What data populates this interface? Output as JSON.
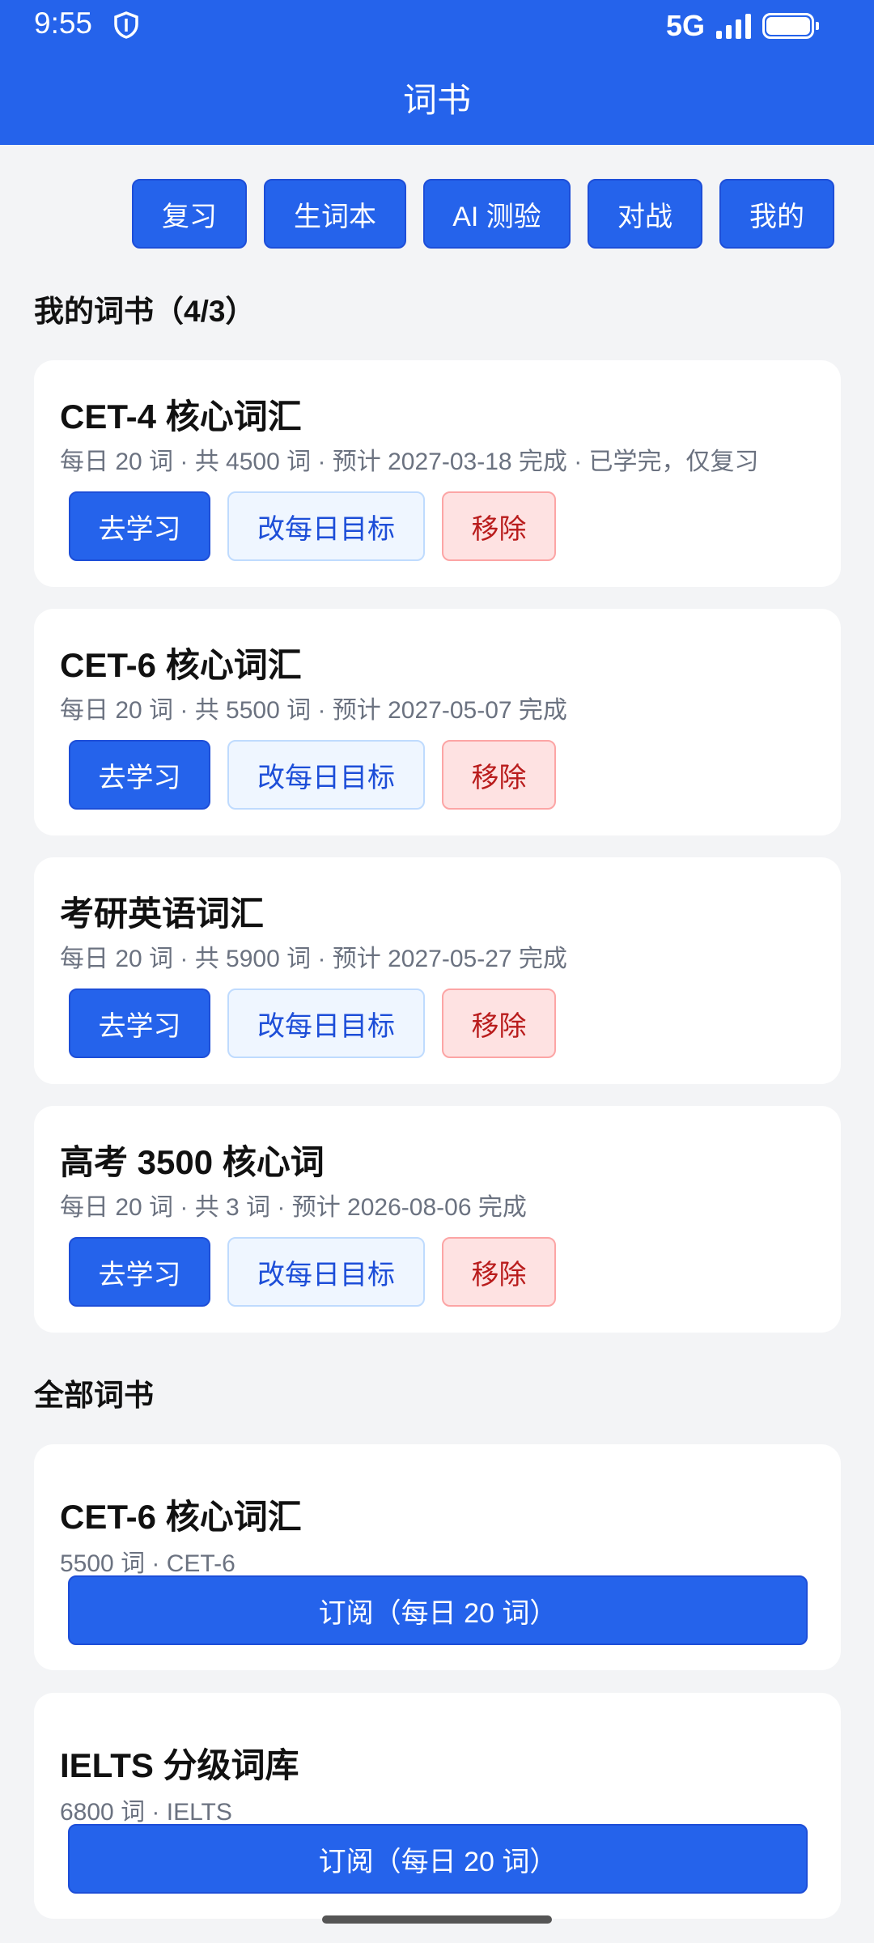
{
  "status_bar": {
    "time": "9:55",
    "network": "5G",
    "icons": [
      "shield-icon",
      "signal-icon",
      "battery-icon"
    ]
  },
  "header": {
    "title": "词书"
  },
  "nav": [
    {
      "label": "复习"
    },
    {
      "label": "生词本"
    },
    {
      "label": "AI 测验"
    },
    {
      "label": "对战"
    },
    {
      "label": "我的"
    }
  ],
  "my_books": {
    "title": "我的词书（4/3）",
    "items": [
      {
        "title": "CET-4 核心词汇",
        "meta": "每日 20 词 · 共 4500 词 · 预计 2027-03-18 完成 · 已学完，仅复习",
        "study": "去学习",
        "edit": "改每日目标",
        "remove": "移除"
      },
      {
        "title": "CET-6 核心词汇",
        "meta": "每日 20 词 · 共 5500 词 · 预计 2027-05-07 完成",
        "study": "去学习",
        "edit": "改每日目标",
        "remove": "移除"
      },
      {
        "title": "考研英语词汇",
        "meta": "每日 20 词 · 共 5900 词 · 预计 2027-05-27 完成",
        "study": "去学习",
        "edit": "改每日目标",
        "remove": "移除"
      },
      {
        "title": "高考 3500 核心词",
        "meta": "每日 20 词 · 共 3 词 · 预计 2026-08-06 完成",
        "study": "去学习",
        "edit": "改每日目标",
        "remove": "移除"
      }
    ]
  },
  "all_books": {
    "title": "全部词书",
    "items": [
      {
        "title": "CET-6 核心词汇",
        "meta": "5500 词 · CET-6",
        "subscribe": "订阅（每日 20 词）"
      },
      {
        "title": "IELTS 分级词库",
        "meta": "6800 词 · IELTS",
        "subscribe": "订阅（每日 20 词）"
      }
    ]
  },
  "colors": {
    "primary": "#2563eb",
    "background": "#f3f4f6",
    "danger_bg": "#fee2e2",
    "danger_text": "#b91c1c",
    "secondary_bg": "#eff6ff"
  }
}
